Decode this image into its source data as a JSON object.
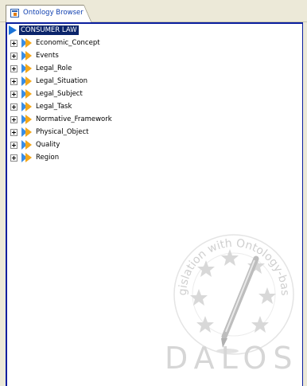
{
  "tab": {
    "label": "Ontology Browser",
    "icon": "ontology-browser-icon"
  },
  "tree": {
    "root": {
      "label": "CONSUMER LAW",
      "icon": "root-class-icon"
    },
    "items": [
      {
        "label": "Economic_Concept"
      },
      {
        "label": "Events"
      },
      {
        "label": "Legal_Role"
      },
      {
        "label": "Legal_Situation"
      },
      {
        "label": "Legal_Subject"
      },
      {
        "label": "Legal_Task"
      },
      {
        "label": "Normative_Framework"
      },
      {
        "label": "Physical_Object"
      },
      {
        "label": "Quality"
      },
      {
        "label": "Region"
      }
    ]
  },
  "watermark": {
    "arc_text": "Drafting Legislation with Ontology-based Support",
    "brand": "DALOS"
  },
  "colors": {
    "accent": "#0a1e9e",
    "selection": "#0a246a",
    "class_icon_blue": "#3a8ee6",
    "class_icon_orange": "#f3a71a"
  }
}
